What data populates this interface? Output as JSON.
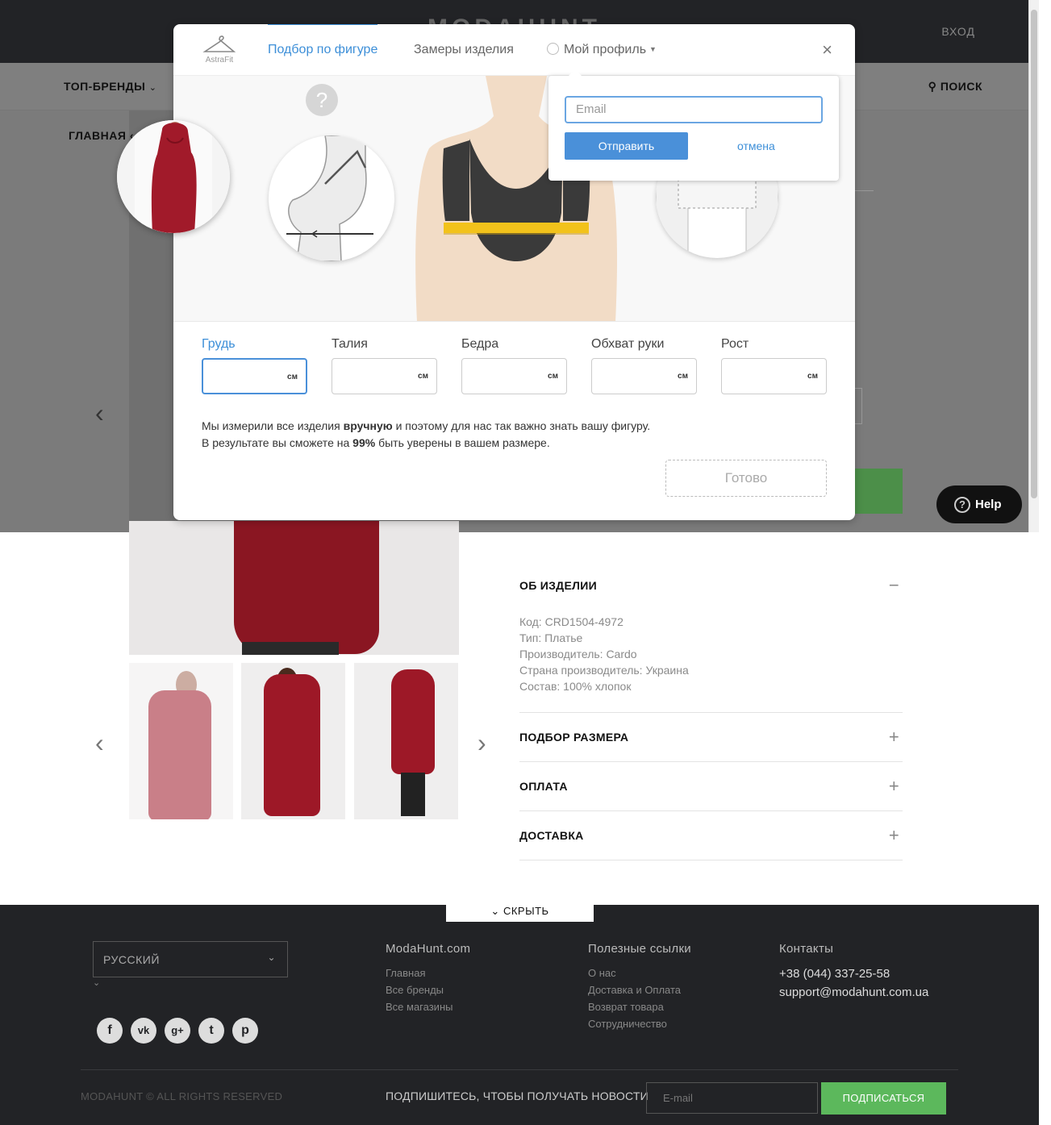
{
  "site": {
    "logo": "MODAHUNT",
    "login": "ВХОД",
    "nav_brands": "ТОП-БРЕНДЫ",
    "nav_search": "ПОИСК",
    "breadcrumb_home": "ГЛАВНАЯ"
  },
  "product": {
    "accordion": [
      {
        "title": "ОБ ИЗДЕЛИИ",
        "sign": "−"
      },
      {
        "title": "ПОДБОР РАЗМЕРА",
        "sign": "+"
      },
      {
        "title": "ОПЛАТА",
        "sign": "+"
      },
      {
        "title": "ДОСТАВКА",
        "sign": "+"
      }
    ],
    "details": [
      "Код: CRD1504-4972",
      "Тип: Платье",
      "Производитель: Cardo",
      "Страна производитель: Украина",
      "Состав: 100% хлопок"
    ]
  },
  "help_button": "Help",
  "modal": {
    "logo_text": "AstraFit",
    "tabs": [
      "Подбор по фигуре",
      "Замеры изделия",
      "Мой профиль"
    ],
    "active_tab": 0,
    "close": "×",
    "question": "?",
    "fields": [
      {
        "label": "Грудь",
        "unit": "см",
        "value": ""
      },
      {
        "label": "Талия",
        "unit": "см",
        "value": ""
      },
      {
        "label": "Бедра",
        "unit": "см",
        "value": ""
      },
      {
        "label": "Обхват руки",
        "unit": "см",
        "value": ""
      },
      {
        "label": "Рост",
        "unit": "см",
        "value": ""
      }
    ],
    "note_part1": "Мы измерили все изделия ",
    "note_bold1": "вручную",
    "note_part2": " и поэтому для нас так важно знать вашу фигуру.",
    "note_line2_part1": "В результате вы сможете на ",
    "note_bold2": "99%",
    "note_line2_part2": " быть уверены в вашем размере.",
    "ready_button": "Готово"
  },
  "popover": {
    "email_placeholder": "Email",
    "send_button": "Отправить",
    "cancel_link": "отмена"
  },
  "footer": {
    "hide_tab": "СКРЫТЬ",
    "language": "РУССКИЙ",
    "socials": [
      "facebook-icon",
      "vk-icon",
      "google-plus-icon",
      "twitter-icon",
      "pinterest-icon"
    ],
    "col1_title": "ModaHunt.com",
    "col1_links": [
      "Главная",
      "Все бренды",
      "Все магазины"
    ],
    "col2_title": "Полезные ссылки",
    "col2_links": [
      "О нас",
      "Доставка и Оплата",
      "Возврат товара",
      "Сотрудничество"
    ],
    "col3_title": "Контакты",
    "phone": "+38 (044) 337-25-58",
    "email": "support@modahunt.com.ua",
    "copyright": "MODAHUNT © ALL RIGHTS RESERVED",
    "subscribe_text": "ПОДПИШИТЕСЬ, ЧТОБЫ ПОЛУЧАТЬ НОВОСТИ",
    "subscribe_placeholder": "E-mail",
    "subscribe_button": "ПОДПИСАТЬСЯ"
  },
  "colors": {
    "accent": "#3d8fd8",
    "green": "#5cb85c",
    "dress": "#9d1827",
    "dark": "#222326"
  }
}
